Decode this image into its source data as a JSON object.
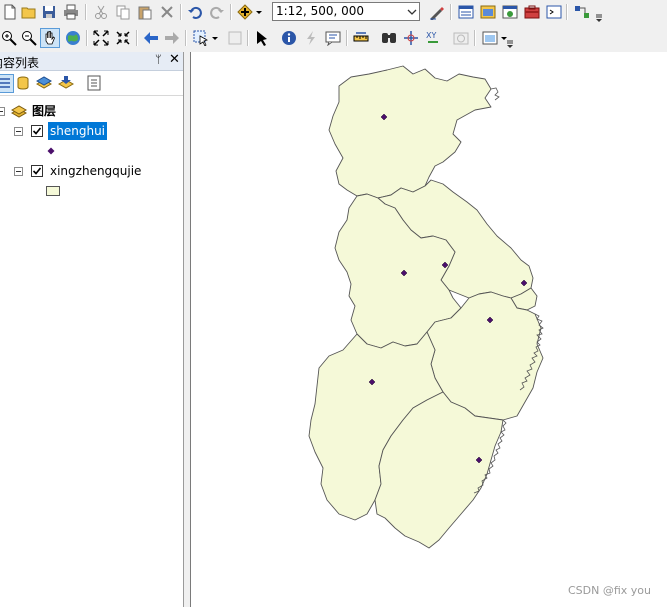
{
  "toolbar_main": {
    "scale_value": "1:12, 500, 000",
    "icons": [
      "new-icon",
      "open-icon",
      "save-icon",
      "print-icon",
      "cut-icon",
      "copy-icon",
      "paste-icon",
      "delete-icon",
      "undo-icon",
      "redo-icon",
      "add-data-icon",
      "editor-icon",
      "layout-view-icon",
      "catalog-icon",
      "search-window-icon",
      "arctoolbox-icon",
      "python-icon",
      "model-builder-icon"
    ]
  },
  "toolbar_tools": {
    "icons": [
      "zoom-in-icon",
      "zoom-out-icon",
      "pan-icon",
      "full-extent-icon",
      "fixed-zoom-in-icon",
      "fixed-zoom-out-icon",
      "back-icon",
      "forward-icon",
      "select-features-icon",
      "clear-selection-icon",
      "select-elements-icon",
      "identify-icon",
      "hyperlink-icon",
      "html-popup-icon",
      "measure-icon",
      "find-icon",
      "goto-xy-icon",
      "xy-icon",
      "time-slider-icon",
      "viewer-icon"
    ]
  },
  "toc": {
    "title": "内容列表",
    "pin": "ᛘ",
    "close": "✕",
    "root_group": "图层",
    "layers": [
      {
        "name": "shenghui",
        "checked": true,
        "selected": true,
        "symbol": "point"
      },
      {
        "name": "xingzhengqujie",
        "checked": true,
        "selected": false,
        "symbol": "polygon"
      }
    ]
  },
  "map": {
    "fill_color": "#f5f9d8",
    "outline_color": "#555555",
    "point_color": "#4b0f6b",
    "watermark": "CSDN @fix you"
  }
}
